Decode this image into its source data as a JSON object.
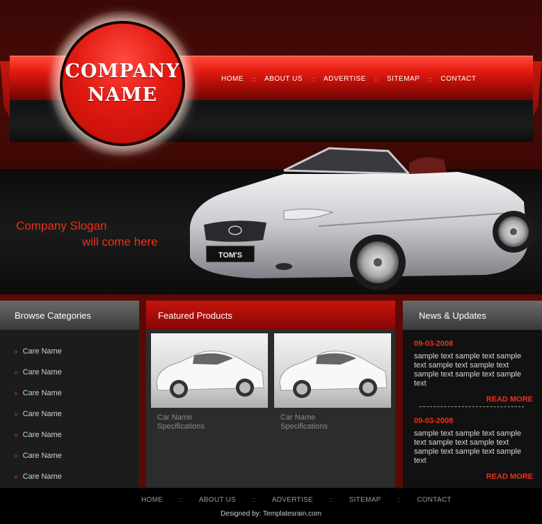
{
  "logo": {
    "line1": "COMPANY",
    "line2": "NAME"
  },
  "top_nav": [
    "HOME",
    "ABOUT US",
    "ADVERTISE",
    "SITEMAP",
    "CONTACT"
  ],
  "nav_separator": "::",
  "hero": {
    "slogan_line1": "Company Slogan",
    "slogan_line2": "will come here",
    "plate_text": "TOM'S"
  },
  "browse": {
    "title": "Browse Categories",
    "items": [
      "Care Name",
      "Care Name",
      "Care Name",
      "Care Name",
      "Care Name",
      "Care Name",
      "Care Name"
    ]
  },
  "featured": {
    "title": "Featured Products",
    "products": [
      {
        "name": "Car Name",
        "spec": "Specifications"
      },
      {
        "name": "Car Name",
        "spec": "Specifications"
      }
    ]
  },
  "news": {
    "title": "News & Updates",
    "items": [
      {
        "date": "09-03-2008",
        "text": "sample text sample text sample text sample text sample text sample text sample text sample text",
        "more": "READ MORE"
      },
      {
        "date": "09-03-2008",
        "text": "sample text sample text sample text sample text sample text sample text sample text sample text",
        "more": "READ MORE"
      }
    ]
  },
  "footer": {
    "nav": [
      "HOME",
      "ABOUT US",
      "ADVERTISE",
      "SITEMAP",
      "CONTACT"
    ],
    "credit": "Designed by: Templatesrain.com"
  },
  "colors": {
    "accent": "#e8321c",
    "brand_red": "#d21a10",
    "header_bg": "#3a0805"
  }
}
